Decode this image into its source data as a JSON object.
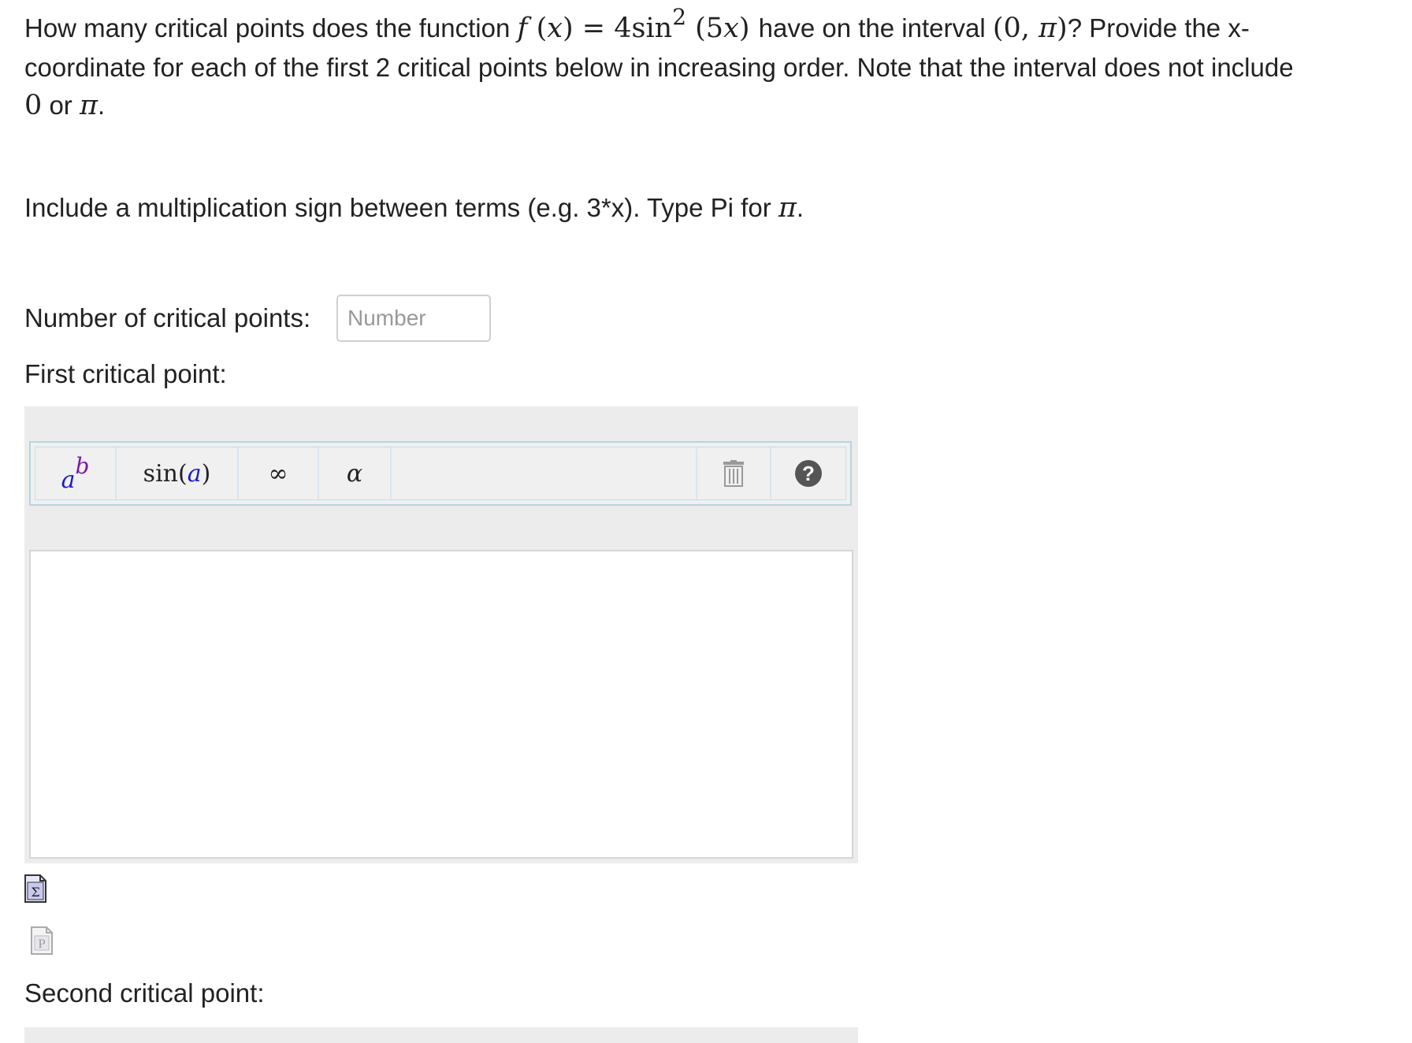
{
  "question": {
    "intro": "How many critical points does the function",
    "f": "f",
    "x1": "x",
    "eq": " = 4sin",
    "power": "2",
    "arg": "(5",
    "x2": "x",
    "argclose": ")",
    "mid": " have on the interval",
    "interval_open": "(0, ",
    "pi1": "π",
    "interval_close": ")",
    "rest": "? Provide the x-coordinate for each of the first 2 critical points below in increasing order. Note that the interval does not include",
    "zero": "0",
    "or": " or ",
    "pi2": "π",
    "end": "."
  },
  "instruction": {
    "text": "Include a multiplication sign between terms (e.g. 3*x). Type Pi for ",
    "pi": "π",
    "end": "."
  },
  "count_field": {
    "label": "Number of critical points:",
    "placeholder": "Number",
    "value": ""
  },
  "first_point": {
    "label": "First critical point:"
  },
  "toolbar": {
    "power_base": "a",
    "power_exp": "b",
    "sin_label": "sin",
    "sin_open": " (",
    "sin_arg": "a",
    "sin_close": ")",
    "infinity": "∞",
    "alpha": "α",
    "help": "?"
  },
  "second_point": {
    "label": "Second critical point:"
  },
  "icons": {
    "formula": "sigma-document-icon",
    "preview": "preview-document-icon",
    "delete": "trash-icon",
    "help": "help-icon"
  }
}
